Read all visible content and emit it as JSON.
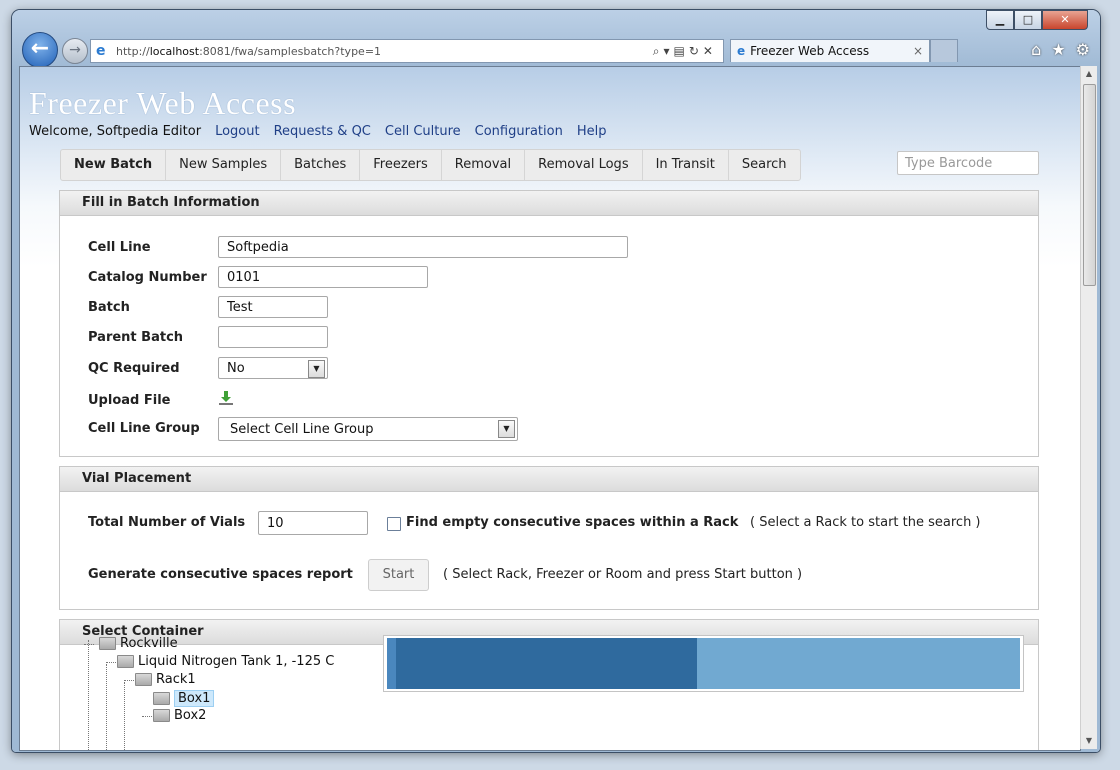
{
  "browser": {
    "address": {
      "scheme": "http://",
      "host": "localhost",
      "rest": ":8081/fwa/samplesbatch?type=1"
    },
    "tab_title": "Freezer Web Access",
    "tab_close": "×"
  },
  "app": {
    "title": "Freezer Web Access",
    "welcome": "Welcome, Softpedia Editor",
    "links": [
      "Logout",
      "Requests & QC",
      "Cell Culture",
      "Configuration",
      "Help"
    ]
  },
  "menu": [
    "New Batch",
    "New Samples",
    "Batches",
    "Freezers",
    "Removal",
    "Removal Logs",
    "In Transit",
    "Search"
  ],
  "barcode_placeholder": "Type Barcode",
  "batch": {
    "header": "Fill in Batch Information",
    "cell_line_label": "Cell Line",
    "cell_line_value": "Softpedia",
    "catalog_label": "Catalog Number",
    "catalog_value": "0101",
    "batch_label": "Batch",
    "batch_value": "Test",
    "parent_label": "Parent Batch",
    "parent_value": "",
    "qc_label": "QC Required",
    "qc_value": "No",
    "upload_label": "Upload File",
    "group_label": "Cell Line Group",
    "group_value": "Select Cell Line Group"
  },
  "vial": {
    "header": "Vial Placement",
    "total_label": "Total Number of Vials",
    "total_value": "10",
    "find_label": "Find empty consecutive spaces within a Rack",
    "find_hint": "( Select a Rack to start the search )",
    "report_label": "Generate consecutive spaces report",
    "start_label": "Start",
    "report_hint": "( Select Rack, Freezer or Room and press Start button )"
  },
  "container": {
    "header": "Select Container",
    "tree": {
      "root": "Rockville",
      "tank": "Liquid Nitrogen Tank 1, -125 C",
      "rack": "Rack1",
      "box1": "Box1",
      "box2": "Box2"
    },
    "capacity_fraction": 0.49,
    "colors": {
      "used": "#2f6a9e",
      "free": "#71a9d1"
    }
  }
}
